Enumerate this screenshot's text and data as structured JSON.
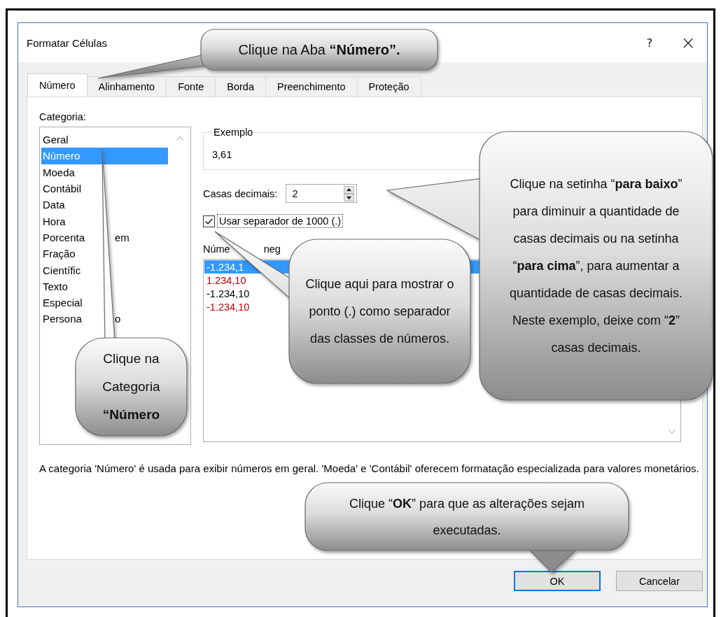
{
  "window": {
    "title": "Formatar Células",
    "help": "?",
    "close": "×"
  },
  "tabs": [
    {
      "label": "Número",
      "selected": true
    },
    {
      "label": "Alinhamento",
      "selected": false
    },
    {
      "label": "Fonte",
      "selected": false
    },
    {
      "label": "Borda",
      "selected": false
    },
    {
      "label": "Preenchimento",
      "selected": false
    },
    {
      "label": "Proteção",
      "selected": false
    }
  ],
  "category": {
    "label": "Categoria:",
    "items": [
      {
        "label": "Geral",
        "selected": false
      },
      {
        "label": "Número",
        "selected": true
      },
      {
        "label": "Moeda",
        "selected": false
      },
      {
        "label": "Contábil",
        "selected": false
      },
      {
        "label": "Data",
        "selected": false
      },
      {
        "label": "Hora",
        "selected": false
      },
      {
        "label": "Porcenta",
        "tail": "em",
        "selected": false
      },
      {
        "label": "Fração",
        "selected": false
      },
      {
        "label": "Científic",
        "selected": false
      },
      {
        "label": "Texto",
        "selected": false
      },
      {
        "label": "Especial",
        "selected": false
      },
      {
        "label": "Persona",
        "tail": "o",
        "selected": false
      }
    ]
  },
  "sample": {
    "legend": "Exemplo",
    "value": "3,61"
  },
  "decimals": {
    "label": "Casas decimais:",
    "value": "2"
  },
  "separator": {
    "label": "Usar separador de 1000 (.)",
    "checked": true,
    "focused": true
  },
  "negatives": {
    "label_parts": [
      "Núme",
      "neg"
    ],
    "items": [
      {
        "text": "-1.234,1",
        "selected": true
      },
      {
        "text": "1.234,10",
        "color": "#c00000",
        "selected": false
      },
      {
        "text": "-1.234,10",
        "color": "#000000",
        "selected": false
      },
      {
        "text": "-1.234,10",
        "color": "#c00000",
        "selected": false
      }
    ]
  },
  "description": "A categoria 'Número' é usada para exibir números em geral. 'Moeda' e 'Contábil' oferecem formatação especializada para valores monetários.",
  "buttons": [
    {
      "label": "OK",
      "default": true
    },
    {
      "label": "Cancelar",
      "default": false
    }
  ],
  "callouts": [
    {
      "text": "Clique na Aba **“Número”.**"
    },
    {
      "text": "Clique na Categoria **“Número**"
    },
    {
      "text": "Clique aqui para mostrar o ponto (.) como separador das classes de números."
    },
    {
      "text": "Clique na setinha “**para baixo**” para diminuir a quantidade de casas decimais ou na setinha “**para cima**”, para aumentar a quantidade de casas decimais. Neste exemplo, deixe com “**2**” casas decimais."
    },
    {
      "text": "Clique “**OK**” para que as alterações sejam executadas."
    }
  ]
}
